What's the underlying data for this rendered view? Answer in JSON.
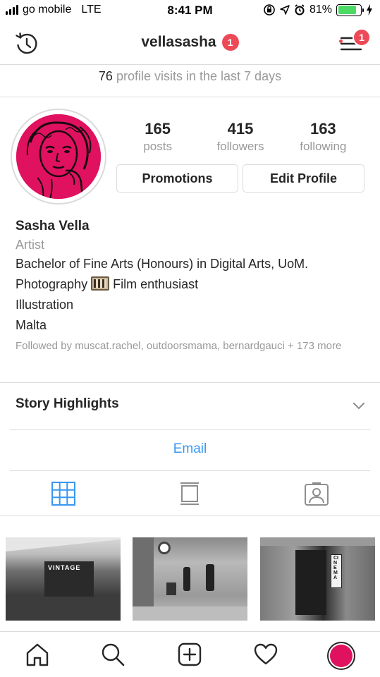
{
  "status_bar": {
    "carrier": "go mobile",
    "network": "LTE",
    "time": "8:41 PM",
    "battery": "81%",
    "battery_level": 0.81,
    "battery_color": "#4cd964"
  },
  "nav": {
    "username": "vellasasha",
    "title_badge": "1",
    "menu_badge": "1",
    "history_icon": "history-icon",
    "menu_icon": "menu-icon"
  },
  "insights": {
    "visits_count": "76",
    "visits_text": "profile visits in the last 7 days"
  },
  "stats": [
    {
      "value": "165",
      "label": "posts"
    },
    {
      "value": "415",
      "label": "followers"
    },
    {
      "value": "163",
      "label": "following"
    }
  ],
  "buttons": {
    "promotions": "Promotions",
    "edit_profile": "Edit Profile"
  },
  "bio": {
    "name": "Sasha Vella",
    "category": "Artist",
    "line1": "Bachelor of Fine Arts (Honours) in Digital Arts, UoM.",
    "line2_a": "Photography",
    "line2_b": "Film enthusiast",
    "line3": "Illustration",
    "line4": "Malta",
    "followed_by": "Followed by muscat.rachel, outdoorsmama, bernardgauci + 173 more"
  },
  "highlights": {
    "label": "Story Highlights"
  },
  "contact": {
    "email_label": "Email"
  },
  "photos": {
    "p1_sign": "VINTAGE",
    "p3_sign": "CINEMA"
  },
  "colors": {
    "accent_blue": "#3897f0",
    "badge_red": "#ed4956",
    "avatar_pink": "#e0125f"
  }
}
